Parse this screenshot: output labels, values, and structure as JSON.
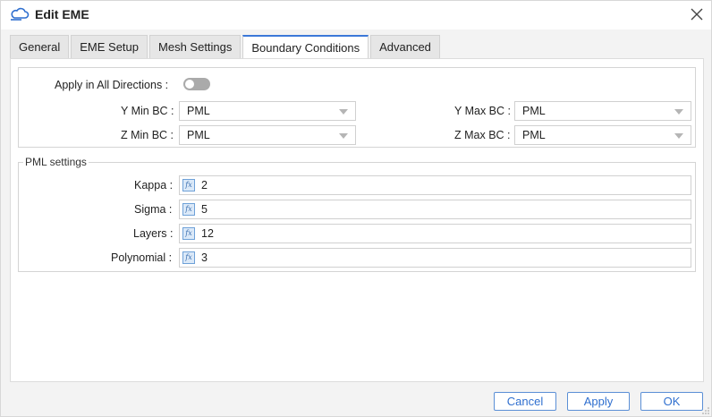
{
  "window": {
    "title": "Edit EME",
    "icon": "cloud-icon",
    "close_icon": "close-icon"
  },
  "tabs": [
    {
      "label": "General",
      "active": false
    },
    {
      "label": "EME Setup",
      "active": false
    },
    {
      "label": "Mesh Settings",
      "active": false
    },
    {
      "label": "Boundary Conditions",
      "active": true
    },
    {
      "label": "Advanced",
      "active": false
    }
  ],
  "boundary": {
    "apply_all_label": "Apply in All Directions :",
    "apply_all_on": false,
    "y_min_label": "Y Min BC :",
    "y_min_value": "PML",
    "y_max_label": "Y Max BC :",
    "y_max_value": "PML",
    "z_min_label": "Z Min BC :",
    "z_min_value": "PML",
    "z_max_label": "Z Max BC :",
    "z_max_value": "PML"
  },
  "pml": {
    "legend": "PML settings",
    "fx_glyph": "fx",
    "fields": [
      {
        "label": "Kappa :",
        "value": "2"
      },
      {
        "label": "Sigma :",
        "value": "5"
      },
      {
        "label": "Layers :",
        "value": "12"
      },
      {
        "label": "Polynomial :",
        "value": "3"
      }
    ]
  },
  "buttons": {
    "cancel": "Cancel",
    "apply": "Apply",
    "ok": "OK"
  },
  "colors": {
    "accent": "#3b78d8",
    "toggle_off": "#aaaaaa",
    "button_text": "#2f6fcf"
  }
}
